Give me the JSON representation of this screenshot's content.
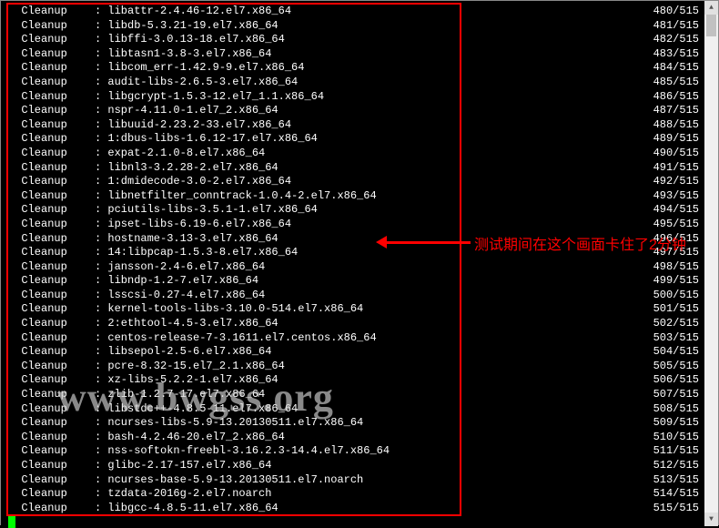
{
  "watermark": "www.bwgss.org",
  "annotation_text": "测试期间在这个画面卡住了2分钟",
  "totals": 515,
  "rows": [
    {
      "action": "Cleanup",
      "pkg": "libattr-2.4.46-12.el7.x86_64",
      "n": 480
    },
    {
      "action": "Cleanup",
      "pkg": "libdb-5.3.21-19.el7.x86_64",
      "n": 481
    },
    {
      "action": "Cleanup",
      "pkg": "libffi-3.0.13-18.el7.x86_64",
      "n": 482
    },
    {
      "action": "Cleanup",
      "pkg": "libtasn1-3.8-3.el7.x86_64",
      "n": 483
    },
    {
      "action": "Cleanup",
      "pkg": "libcom_err-1.42.9-9.el7.x86_64",
      "n": 484
    },
    {
      "action": "Cleanup",
      "pkg": "audit-libs-2.6.5-3.el7.x86_64",
      "n": 485
    },
    {
      "action": "Cleanup",
      "pkg": "libgcrypt-1.5.3-12.el7_1.1.x86_64",
      "n": 486
    },
    {
      "action": "Cleanup",
      "pkg": "nspr-4.11.0-1.el7_2.x86_64",
      "n": 487
    },
    {
      "action": "Cleanup",
      "pkg": "libuuid-2.23.2-33.el7.x86_64",
      "n": 488
    },
    {
      "action": "Cleanup",
      "pkg": "1:dbus-libs-1.6.12-17.el7.x86_64",
      "n": 489
    },
    {
      "action": "Cleanup",
      "pkg": "expat-2.1.0-8.el7.x86_64",
      "n": 490
    },
    {
      "action": "Cleanup",
      "pkg": "libnl3-3.2.28-2.el7.x86_64",
      "n": 491
    },
    {
      "action": "Cleanup",
      "pkg": "1:dmidecode-3.0-2.el7.x86_64",
      "n": 492
    },
    {
      "action": "Cleanup",
      "pkg": "libnetfilter_conntrack-1.0.4-2.el7.x86_64",
      "n": 493
    },
    {
      "action": "Cleanup",
      "pkg": "pciutils-libs-3.5.1-1.el7.x86_64",
      "n": 494
    },
    {
      "action": "Cleanup",
      "pkg": "ipset-libs-6.19-6.el7.x86_64",
      "n": 495
    },
    {
      "action": "Cleanup",
      "pkg": "hostname-3.13-3.el7.x86_64",
      "n": 496
    },
    {
      "action": "Cleanup",
      "pkg": "14:libpcap-1.5.3-8.el7.x86_64",
      "n": 497
    },
    {
      "action": "Cleanup",
      "pkg": "jansson-2.4-6.el7.x86_64",
      "n": 498
    },
    {
      "action": "Cleanup",
      "pkg": "libndp-1.2-7.el7.x86_64",
      "n": 499
    },
    {
      "action": "Cleanup",
      "pkg": "lsscsi-0.27-4.el7.x86_64",
      "n": 500
    },
    {
      "action": "Cleanup",
      "pkg": "kernel-tools-libs-3.10.0-514.el7.x86_64",
      "n": 501
    },
    {
      "action": "Cleanup",
      "pkg": "2:ethtool-4.5-3.el7.x86_64",
      "n": 502
    },
    {
      "action": "Cleanup",
      "pkg": "centos-release-7-3.1611.el7.centos.x86_64",
      "n": 503
    },
    {
      "action": "Cleanup",
      "pkg": "libsepol-2.5-6.el7.x86_64",
      "n": 504
    },
    {
      "action": "Cleanup",
      "pkg": "pcre-8.32-15.el7_2.1.x86_64",
      "n": 505
    },
    {
      "action": "Cleanup",
      "pkg": "xz-libs-5.2.2-1.el7.x86_64",
      "n": 506
    },
    {
      "action": "Cleanup",
      "pkg": "zlib-1.2.7-17.el7.x86_64",
      "n": 507
    },
    {
      "action": "Cleanup",
      "pkg": "libstdc++-4.8.5-11.el7.x86_64",
      "n": 508
    },
    {
      "action": "Cleanup",
      "pkg": "ncurses-libs-5.9-13.20130511.el7.x86_64",
      "n": 509
    },
    {
      "action": "Cleanup",
      "pkg": "bash-4.2.46-20.el7_2.x86_64",
      "n": 510
    },
    {
      "action": "Cleanup",
      "pkg": "nss-softokn-freebl-3.16.2.3-14.4.el7.x86_64",
      "n": 511
    },
    {
      "action": "Cleanup",
      "pkg": "glibc-2.17-157.el7.x86_64",
      "n": 512
    },
    {
      "action": "Cleanup",
      "pkg": "ncurses-base-5.9-13.20130511.el7.noarch",
      "n": 513
    },
    {
      "action": "Cleanup",
      "pkg": "tzdata-2016g-2.el7.noarch",
      "n": 514
    },
    {
      "action": "Cleanup",
      "pkg": "libgcc-4.8.5-11.el7.x86_64",
      "n": 515
    }
  ]
}
